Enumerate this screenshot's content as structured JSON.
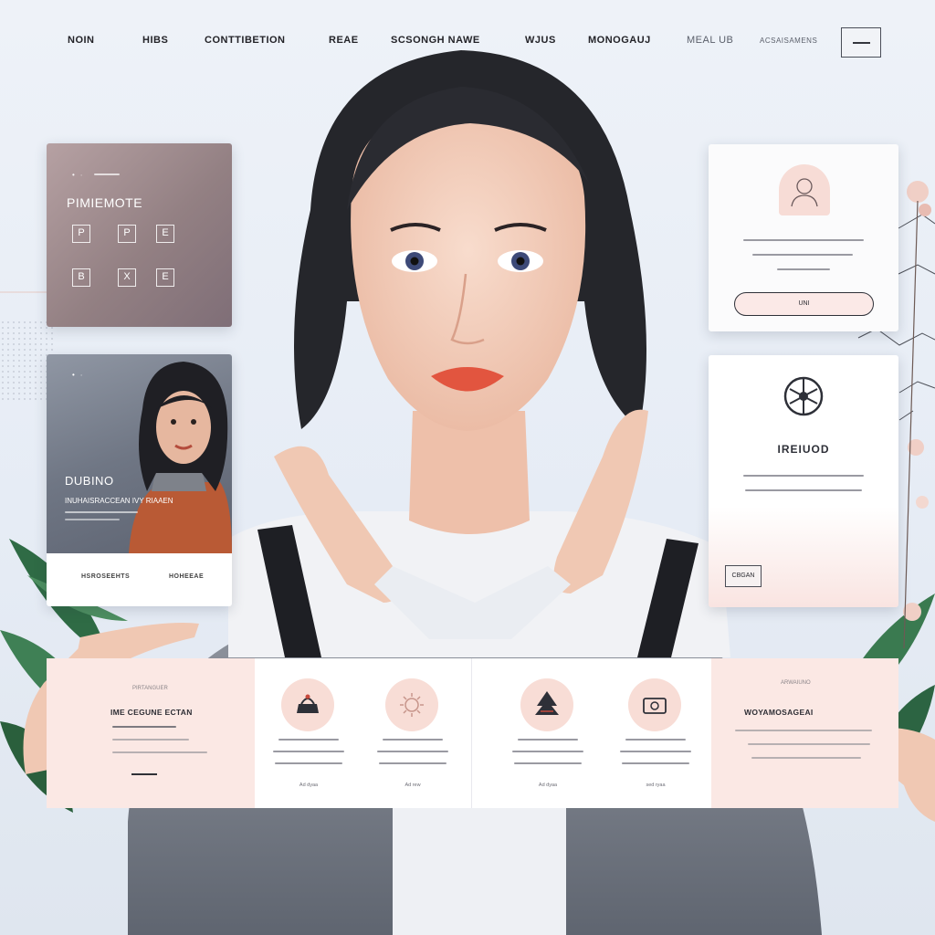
{
  "nav": {
    "items": [
      "NOIN",
      "HIBS",
      "CONTTIBETION",
      "REAE",
      "SCSONGH NAWE",
      "WJUS",
      "MONOGAUJ",
      "MEAL UB",
      "ACSAISAMENS"
    ]
  },
  "cards": {
    "premium": {
      "eyebrow": "• ∙",
      "title": "PIMIEMOTE",
      "icons": [
        "P",
        "P",
        "E",
        "B",
        "X",
        "E"
      ]
    },
    "profile": {
      "eyebrow": "• ∙",
      "name": "DUBINO",
      "subtitle": "INUHAISRACCEAN IVY RIAAEN",
      "links": [
        "HSROSEEHTS",
        "HOHEEAE"
      ]
    },
    "user": {
      "button": "UNI"
    },
    "feature": {
      "title": "IREIUOD",
      "tag": "CBGAN"
    }
  },
  "strip": {
    "left": {
      "eyebrow": "PIRTANGUER",
      "title": "IME CEGUNE ECTAN"
    },
    "features": [
      {
        "icon": "cake-icon",
        "caption": "Ad dyaa"
      },
      {
        "icon": "sparkle-icon",
        "caption": "Ad rew"
      },
      {
        "icon": "tree-icon",
        "caption": "Ad dyaa"
      },
      {
        "icon": "camera-icon",
        "caption": "sed ryaa"
      }
    ],
    "right": {
      "eyebrow": "ARWAIUNO",
      "title": "WOYAMOSAGEAI"
    }
  },
  "colors": {
    "accent_pink": "#f8ddd6",
    "card_mauve": "#938083",
    "ink": "#2e3038"
  }
}
